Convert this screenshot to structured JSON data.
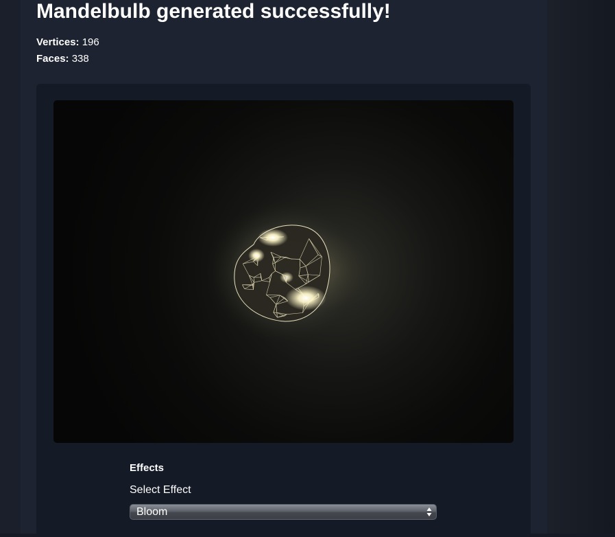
{
  "header": {
    "title": "Mandelbulb generated successfully!"
  },
  "stats": {
    "vertices_label": "Vertices:",
    "vertices_value": "196",
    "faces_label": "Faces:",
    "faces_value": "338"
  },
  "viewer": {
    "object": "mandelbulb-wireframe",
    "effect_color": "#fff6c8"
  },
  "effects": {
    "heading": "Effects",
    "select_label": "Select Effect",
    "selected": "Bloom"
  },
  "colors": {
    "background": "#1e2331",
    "card": "#151a27",
    "viewport": "#060606",
    "glow": "#fff6c8"
  }
}
